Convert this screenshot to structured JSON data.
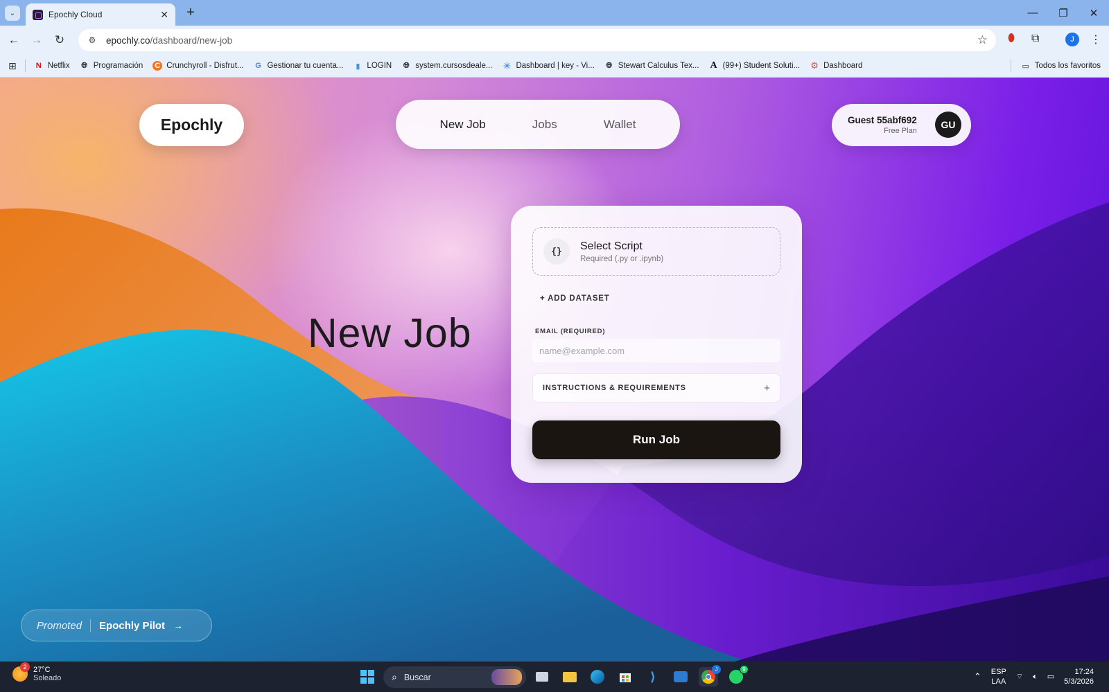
{
  "browser": {
    "tab_title": "Epochly Cloud",
    "url_host": "epochly.co",
    "url_path": "/dashboard/new-job",
    "profile_initial": "J",
    "bookmarks": [
      {
        "label": "Netflix",
        "icon": "N",
        "color": "#e50914"
      },
      {
        "label": "Programación",
        "icon": "globe",
        "color": "#333333"
      },
      {
        "label": "Crunchyroll - Disfrut...",
        "icon": "C",
        "color": "#f47521"
      },
      {
        "label": "Gestionar tu cuenta...",
        "icon": "G",
        "color": "#4285f4"
      },
      {
        "label": "LOGIN",
        "icon": "bars",
        "color": "#4a90d9"
      },
      {
        "label": "system.cursosdeale...",
        "icon": "globe",
        "color": "#333333"
      },
      {
        "label": "Dashboard | key - Vi...",
        "icon": "asterisk",
        "color": "#1a73e8"
      },
      {
        "label": "Stewart Calculus Tex...",
        "icon": "globe",
        "color": "#333333"
      },
      {
        "label": "(99+) Student Soluti...",
        "icon": "A",
        "color": "#111111"
      },
      {
        "label": "Dashboard",
        "icon": "gear",
        "color": "#e84a4a"
      }
    ],
    "all_bookmarks_label": "Todos los favoritos"
  },
  "header": {
    "logo": "Epochly",
    "nav": [
      {
        "label": "New Job",
        "active": true
      },
      {
        "label": "Jobs",
        "active": false
      },
      {
        "label": "Wallet",
        "active": false
      }
    ],
    "user": {
      "name": "Guest 55abf692",
      "plan": "Free Plan",
      "initials": "GU"
    }
  },
  "hero": {
    "title": "New Job"
  },
  "form": {
    "script": {
      "icon": "{}",
      "title": "Select Script",
      "subtitle": "Required (.py or .ipynb)"
    },
    "add_dataset": "+ ADD DATASET",
    "email_label": "EMAIL (REQUIRED)",
    "email_placeholder": "name@example.com",
    "email_value": "",
    "instructions_label": "INSTRUCTIONS & REQUIREMENTS",
    "instructions_icon": "+",
    "run_label": "Run Job"
  },
  "promo": {
    "tag": "Promoted",
    "name": "Epochly Pilot"
  },
  "taskbar": {
    "weather_temp": "27°C",
    "weather_desc": "Soleado",
    "weather_badge": "2",
    "search_placeholder": "Buscar",
    "chrome_badge": "J",
    "whatsapp_badge": "9",
    "lang_top": "ESP",
    "lang_bottom": "LAA",
    "time": "17:24",
    "date": "5/3/2026"
  },
  "colors": {
    "accent_dark": "#1b1512",
    "card_bg": "#ffffff",
    "taskbar": "#1c2230"
  }
}
